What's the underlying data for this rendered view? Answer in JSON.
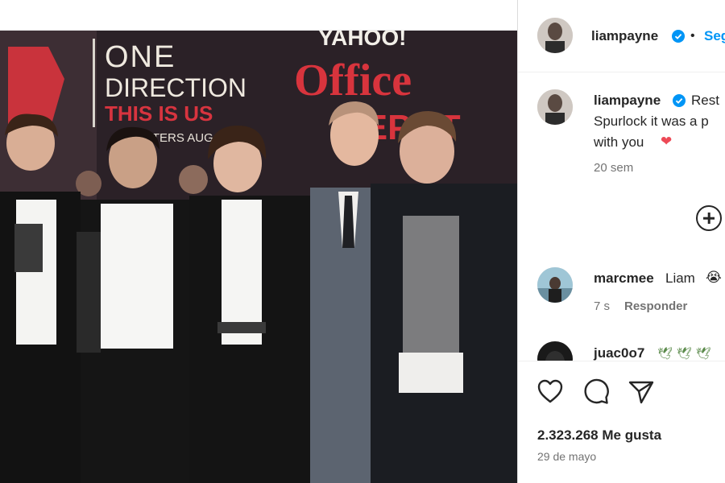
{
  "post": {
    "author": "liampayne",
    "follow_label": "Seg",
    "separator": "•"
  },
  "caption": {
    "author": "liampayne",
    "line1": "Rest",
    "line2": "Spurlock it was a p",
    "line3": "with you",
    "heart": "❤",
    "time": "20 sem"
  },
  "comments": [
    {
      "author": "marcmee",
      "text": "Liam",
      "emoji": "😭",
      "time": "7 s",
      "reply_label": "Responder"
    },
    {
      "author": "juac0o7",
      "text": "🕊 🕊 🕊"
    }
  ],
  "footer": {
    "likes": "2.323.268 Me gusta",
    "date": "29 de mayo"
  },
  "photo": {
    "backdrop_text_1": "ONE",
    "backdrop_text_2": "DIRECTION",
    "backdrop_text_3": "THIS IS US",
    "backdrop_text_4": "THEATERS AUG",
    "backdrop_brand_top": "YAHOO!",
    "backdrop_brand_1": "Office",
    "backdrop_brand_2": "DEPOT"
  },
  "colors": {
    "accent": "#0095f6",
    "verified": "#0095f6",
    "heart": "#ed4956",
    "text_secondary": "#737373"
  }
}
